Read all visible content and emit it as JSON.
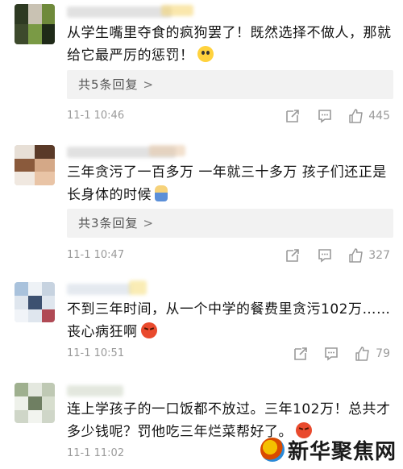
{
  "comments": [
    {
      "text": "从学生嘴里夺食的疯狗罢了！既然选择不做人，那就给它最严厉的惩罚！",
      "emoji": "fearful-face",
      "replies": "共5条回复",
      "chevron": ">",
      "time": "11-1 10:46",
      "likes": "445"
    },
    {
      "text": "三年贪污了一百多万 一年就三十多万 孩子们还正是长身体的时候",
      "emoji": "doll-emoji",
      "replies": "共3条回复",
      "chevron": ">",
      "time": "11-1 10:47",
      "likes": "327"
    },
    {
      "text": "不到三年时间，从一个中学的餐费里贪污102万……丧心病狂啊",
      "emoji": "angry-face",
      "time": "11-1 10:51",
      "likes": "79"
    },
    {
      "text": "连上学孩子的一口饭都不放过。三年102万！总共才多少钱呢？罚他吃三年烂菜帮好了。",
      "emoji": "angry-face",
      "time": "11-1 11:02"
    }
  ],
  "watermark": {
    "text": "新华聚焦网",
    "logo": "xinhua-logo-icon"
  },
  "colors": {
    "reply_bg": "#f2f2f2",
    "meta_gray": "#9a9a9a",
    "text": "#141414"
  }
}
